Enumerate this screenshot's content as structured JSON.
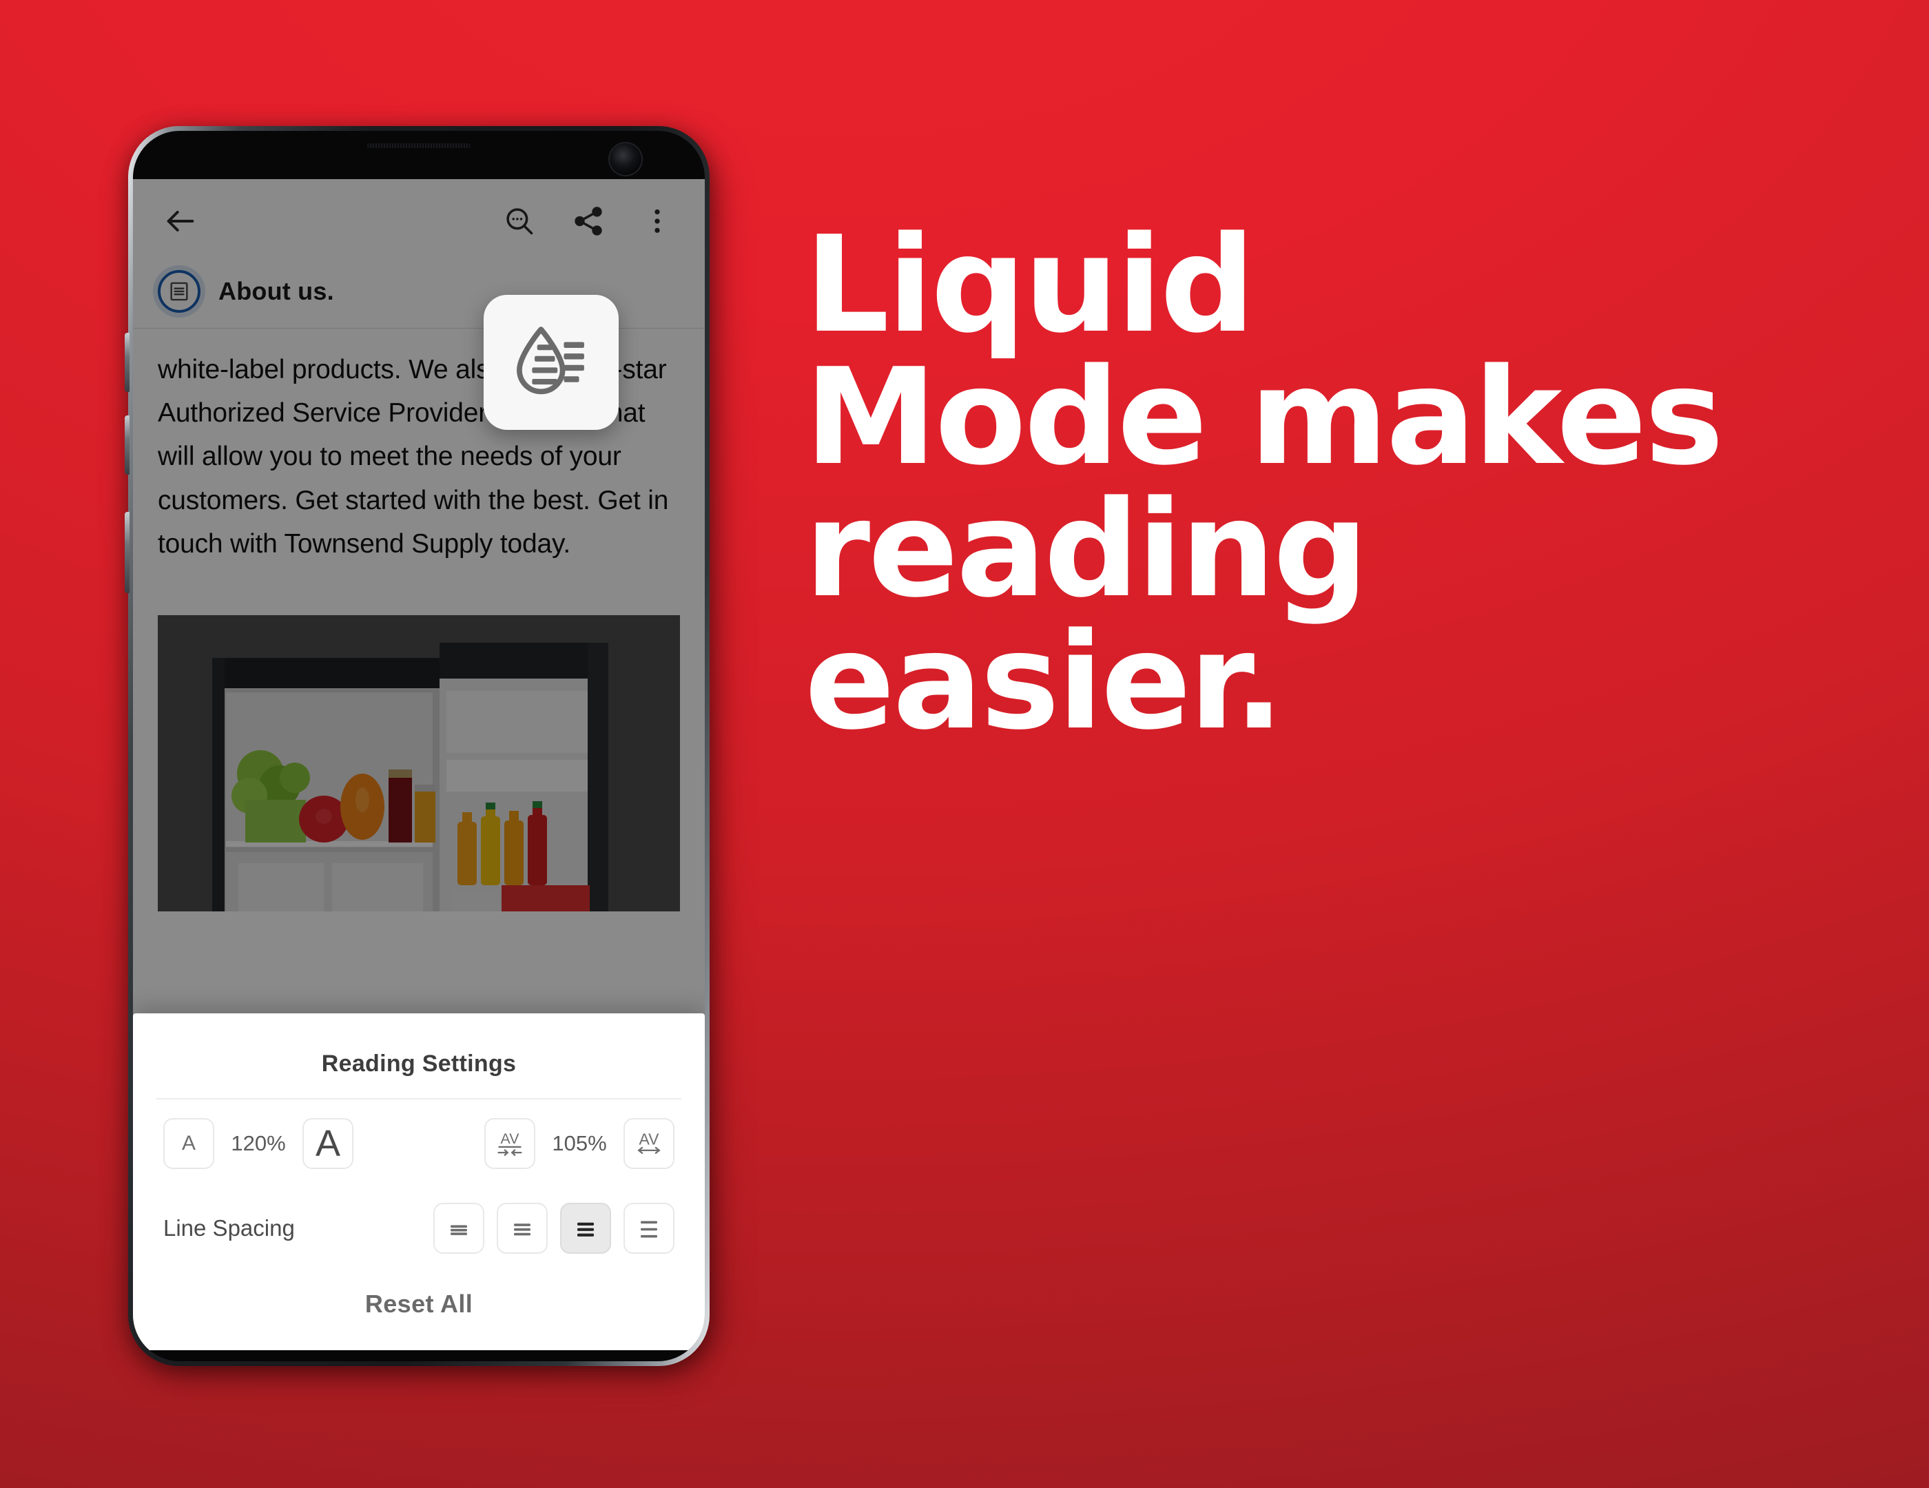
{
  "background": {
    "color_top": "#e4202c",
    "color_bottom": "#a31d22"
  },
  "headline": {
    "text": "Liquid\nMode makes\nreading\neasier.",
    "color": "#ffffff"
  },
  "phone": {
    "app": {
      "toolbar": {
        "back_icon": "arrow-left-icon",
        "search_icon": "search-icon",
        "share_icon": "share-icon",
        "overflow_icon": "more-vertical-icon"
      },
      "article": {
        "badge_icon": "document-outline-icon",
        "badge_color": "#1a5fb4",
        "title": "About us.",
        "body": "white-label products. We also have a 7-star Authorized Service Provider program that will allow you to meet the needs of your customers. Get started with the best. Get in touch with Townsend Supply today.",
        "photo_alt": "open-refrigerator-photo"
      }
    },
    "liquid_badge": {
      "icon": "liquid-mode-droplet-icon"
    },
    "reading_settings": {
      "title": "Reading Settings",
      "font_size": {
        "decrease_label": "A",
        "value": "120%",
        "increase_label": "A"
      },
      "letter_spacing": {
        "decrease_icon": "letter-spacing-decrease-icon",
        "value": "105%",
        "increase_icon": "letter-spacing-increase-icon"
      },
      "line_spacing": {
        "label": "Line Spacing",
        "options": [
          {
            "name": "line-spacing-1",
            "selected": false
          },
          {
            "name": "line-spacing-2",
            "selected": false
          },
          {
            "name": "line-spacing-3",
            "selected": true
          },
          {
            "name": "line-spacing-4",
            "selected": false
          }
        ]
      },
      "reset_label": "Reset All"
    }
  }
}
